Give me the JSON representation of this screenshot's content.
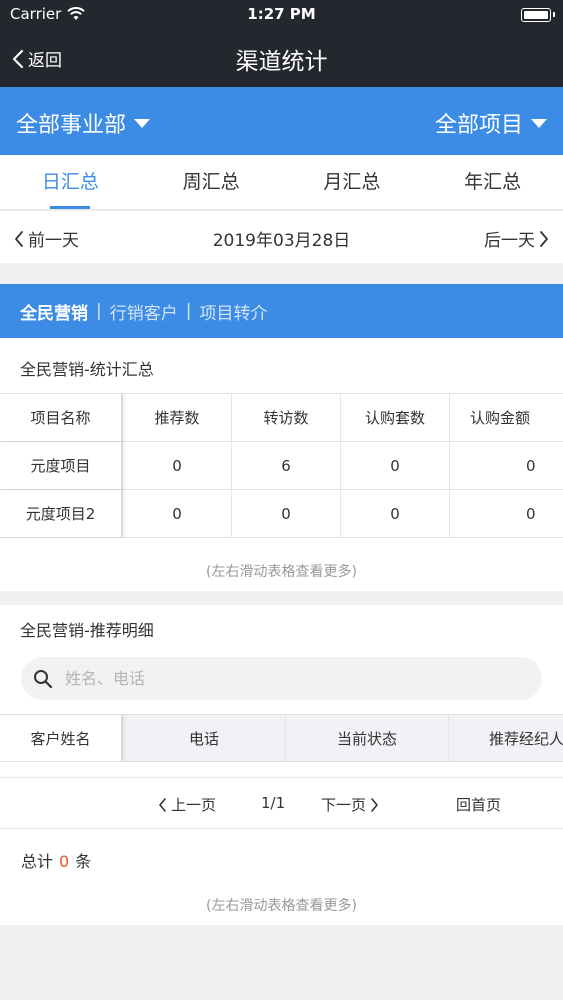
{
  "status": {
    "carrier": "Carrier",
    "time": "1:27 PM"
  },
  "nav": {
    "back_label": "返回",
    "title": "渠道统计"
  },
  "filters": {
    "department": "全部事业部",
    "project": "全部项目"
  },
  "tabs": [
    "日汇总",
    "周汇总",
    "月汇总",
    "年汇总"
  ],
  "date_nav": {
    "prev_label": "前一天",
    "date": "2019年03月28日",
    "next_label": "后一天"
  },
  "segments": {
    "items": [
      "全民营销",
      "行销客户",
      "项目转介"
    ],
    "separator": "|"
  },
  "summary": {
    "title": "全民营销-统计汇总",
    "columns": [
      "项目名称",
      "推荐数",
      "转访数",
      "认购套数",
      "认购金额"
    ],
    "rows": [
      [
        "元度项目",
        "0",
        "6",
        "0",
        "0"
      ],
      [
        "元度项目2",
        "0",
        "0",
        "0",
        "0"
      ]
    ],
    "hint": "(左右滑动表格查看更多)"
  },
  "detail": {
    "title": "全民营销-推荐明细",
    "search_placeholder": "姓名、电话",
    "columns": [
      "客户姓名",
      "电话",
      "当前状态",
      "推荐经纪人"
    ],
    "pager": {
      "prev": "上一页",
      "page": "1/1",
      "next": "下一页",
      "home": "回首页"
    },
    "total": {
      "prefix": "总计",
      "count": "0",
      "suffix": "条"
    },
    "hint": "(左右滑动表格查看更多)"
  },
  "colors": {
    "nav_bg": "#24272e",
    "accent": "#3c8ce6",
    "count_color": "#e8542e"
  }
}
